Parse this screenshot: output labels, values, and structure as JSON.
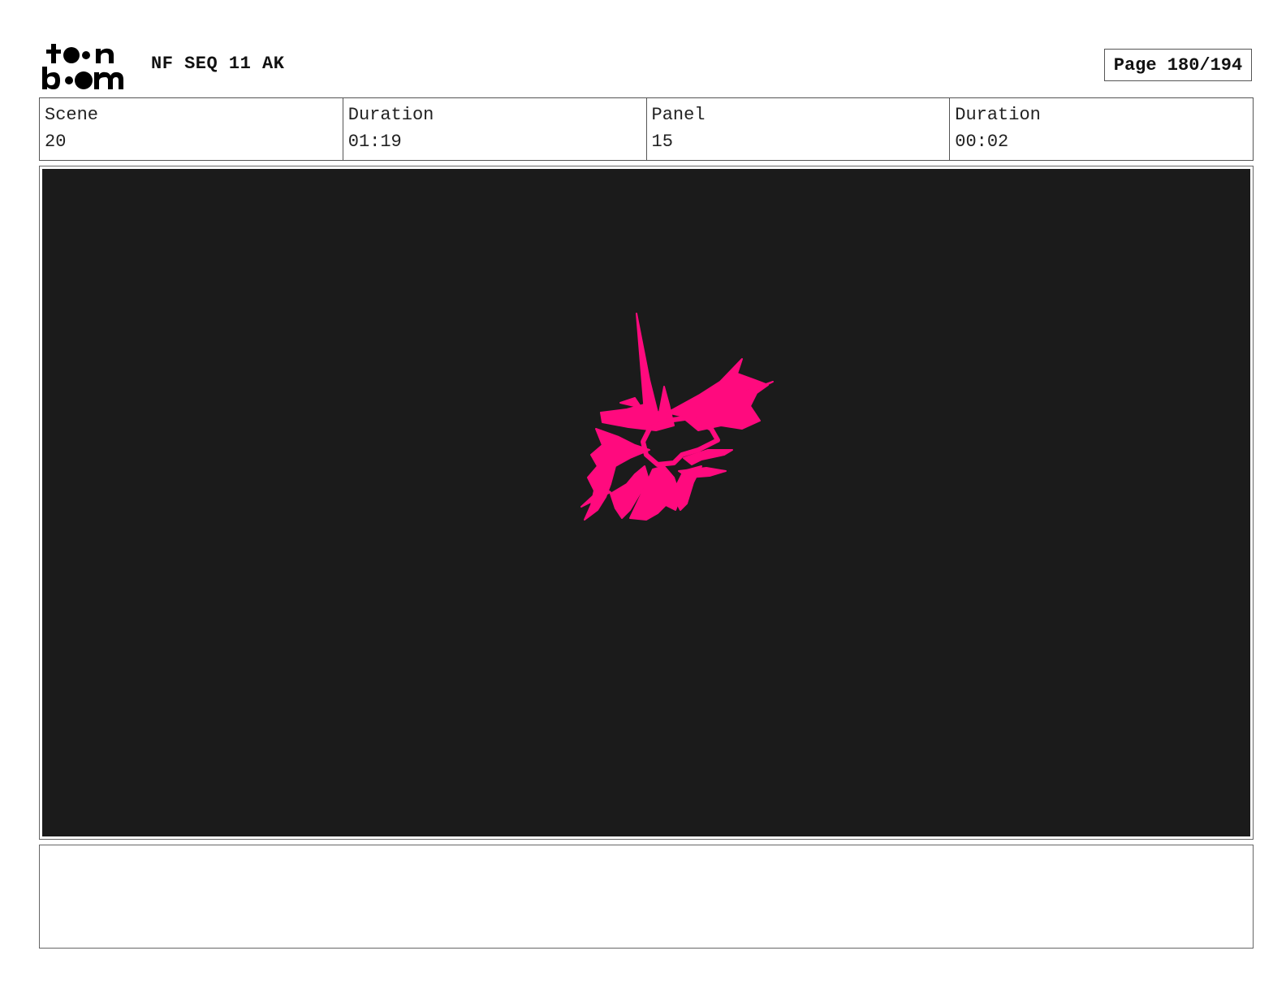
{
  "header": {
    "project_title": "NF SEQ 11 AK",
    "page_label": "Page 180/194",
    "logo_lines": [
      "toon",
      "boom"
    ]
  },
  "info": {
    "scene_label": "Scene",
    "scene_value": "20",
    "scene_duration_label": "Duration",
    "scene_duration_value": "01:19",
    "panel_label": "Panel",
    "panel_value": "15",
    "panel_duration_label": "Duration",
    "panel_duration_value": "00:02"
  },
  "panel_image": {
    "background_color": "#1b1b1b",
    "explosion_color": "#ff0a7e",
    "icon": "explosion-burst"
  },
  "notes": {
    "text": ""
  }
}
